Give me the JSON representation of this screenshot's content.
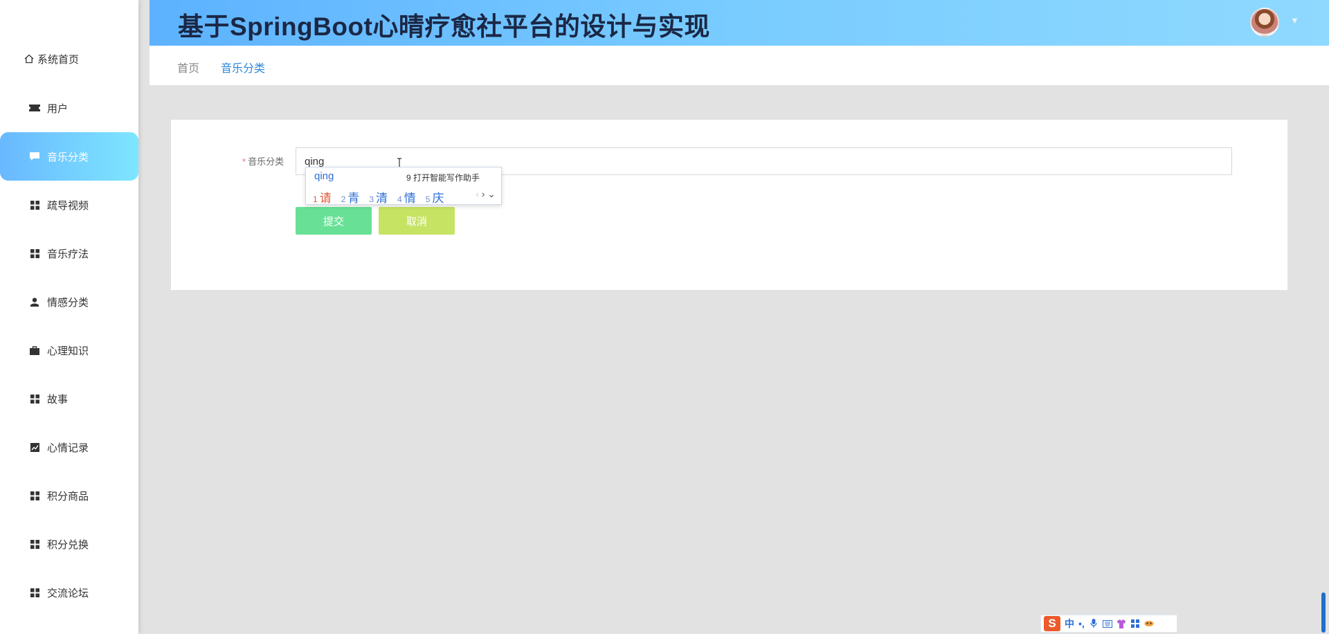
{
  "app": {
    "title": "基于SpringBoot心晴疗愈社平台的设计与实现"
  },
  "sidebar": {
    "items": [
      {
        "label": "系统首页",
        "icon": "home-icon"
      },
      {
        "label": "用户",
        "icon": "ticket-icon"
      },
      {
        "label": "音乐分类",
        "icon": "chat-icon",
        "active": true
      },
      {
        "label": "疏导视频",
        "icon": "grid-icon"
      },
      {
        "label": "音乐疗法",
        "icon": "grid-icon"
      },
      {
        "label": "情感分类",
        "icon": "user-icon"
      },
      {
        "label": "心理知识",
        "icon": "briefcase-icon"
      },
      {
        "label": "故事",
        "icon": "grid-icon"
      },
      {
        "label": "心情记录",
        "icon": "chart-icon"
      },
      {
        "label": "积分商品",
        "icon": "grid-icon"
      },
      {
        "label": "积分兑换",
        "icon": "grid-icon"
      },
      {
        "label": "交流论坛",
        "icon": "grid-icon"
      }
    ]
  },
  "breadcrumb": {
    "home": "首页",
    "current": "音乐分类"
  },
  "form": {
    "required_mark": "*",
    "label": "音乐分类",
    "value": "qing",
    "submit_label": "提交",
    "cancel_label": "取消"
  },
  "ime": {
    "pinyin": "qing",
    "hint_num": "9",
    "hint": "打开智能写作助手",
    "candidates": [
      {
        "n": "1",
        "c": "请"
      },
      {
        "n": "2",
        "c": "青"
      },
      {
        "n": "3",
        "c": "清"
      },
      {
        "n": "4",
        "c": "情"
      },
      {
        "n": "5",
        "c": "庆"
      }
    ],
    "toolbar": {
      "logo": "S",
      "mode": "中",
      "punct": "•,"
    }
  },
  "colors": {
    "header_gradient_start": "#5db2ff",
    "header_gradient_end": "#8fd9ff",
    "active_menu": "#69b8ff",
    "submit": "#68e196",
    "cancel": "#c6e364",
    "link": "#2d87d8"
  }
}
